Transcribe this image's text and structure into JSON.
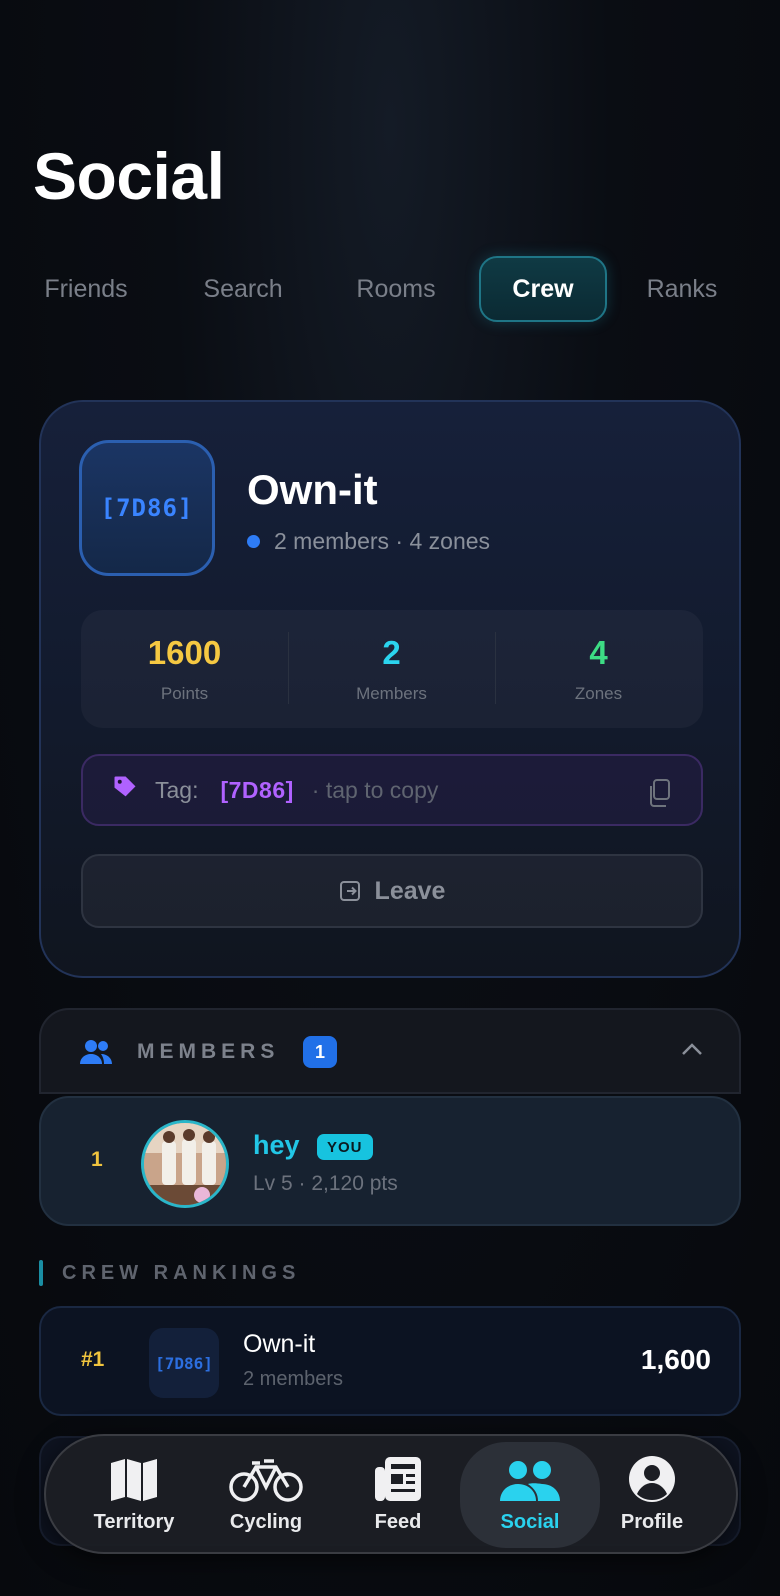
{
  "page": {
    "title": "Social"
  },
  "tabs": [
    {
      "label": "Friends"
    },
    {
      "label": "Search"
    },
    {
      "label": "Rooms"
    },
    {
      "label": "Crew"
    },
    {
      "label": "Ranks"
    }
  ],
  "active_tab": "Crew",
  "crew": {
    "tag_badge": "[7D86]",
    "name": "Own-it",
    "subtitle": "2 members · 4 zones",
    "stats": [
      {
        "value": "1600",
        "label": "Points",
        "color": "#f5c842"
      },
      {
        "value": "2",
        "label": "Members",
        "color": "#2bd4ee"
      },
      {
        "value": "4",
        "label": "Zones",
        "color": "#3ddc84"
      }
    ],
    "tag_label": "Tag:",
    "tag_value": "[7D86]",
    "tag_hint": "· tap to copy",
    "leave_label": "Leave"
  },
  "members": {
    "title": "MEMBERS",
    "count": "1",
    "list": [
      {
        "rank": "1",
        "name": "hey",
        "badge": "YOU",
        "sub": "Lv 5 · 2,120 pts"
      }
    ]
  },
  "rankings": {
    "title": "CREW RANKINGS",
    "rows": [
      {
        "pos": "#1",
        "badge": "[7D86]",
        "name": "Own-it",
        "sub": "2 members",
        "points": "1,600"
      }
    ]
  },
  "nav": {
    "items": [
      {
        "label": "Territory",
        "icon": "map-icon"
      },
      {
        "label": "Cycling",
        "icon": "bicycle-icon"
      },
      {
        "label": "Feed",
        "icon": "newspaper-icon"
      },
      {
        "label": "Social",
        "icon": "users-icon"
      },
      {
        "label": "Profile",
        "icon": "user-circle-icon"
      }
    ],
    "active": "Social"
  },
  "colors": {
    "accent_cyan": "#2ad2ee",
    "accent_blue": "#2e7cf6",
    "accent_purple": "#b062ff",
    "gold": "#f0c43e"
  }
}
